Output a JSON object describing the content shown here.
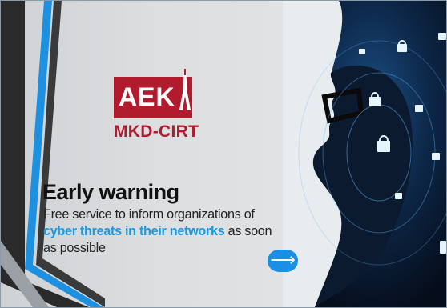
{
  "logo": {
    "text": "AEK",
    "color": "#b01c2e"
  },
  "brand": {
    "name": "MKD-CIRT"
  },
  "slide": {
    "title": "Early warning",
    "desc_before": "Free service to inform organizations of ",
    "desc_highlight": "cyber threats in their networks",
    "desc_after": " as soon as possible",
    "highlight_color": "#1a9ae0"
  },
  "controls": {
    "next_icon": "arrow-right-icon",
    "next_glyph": "⟶"
  }
}
